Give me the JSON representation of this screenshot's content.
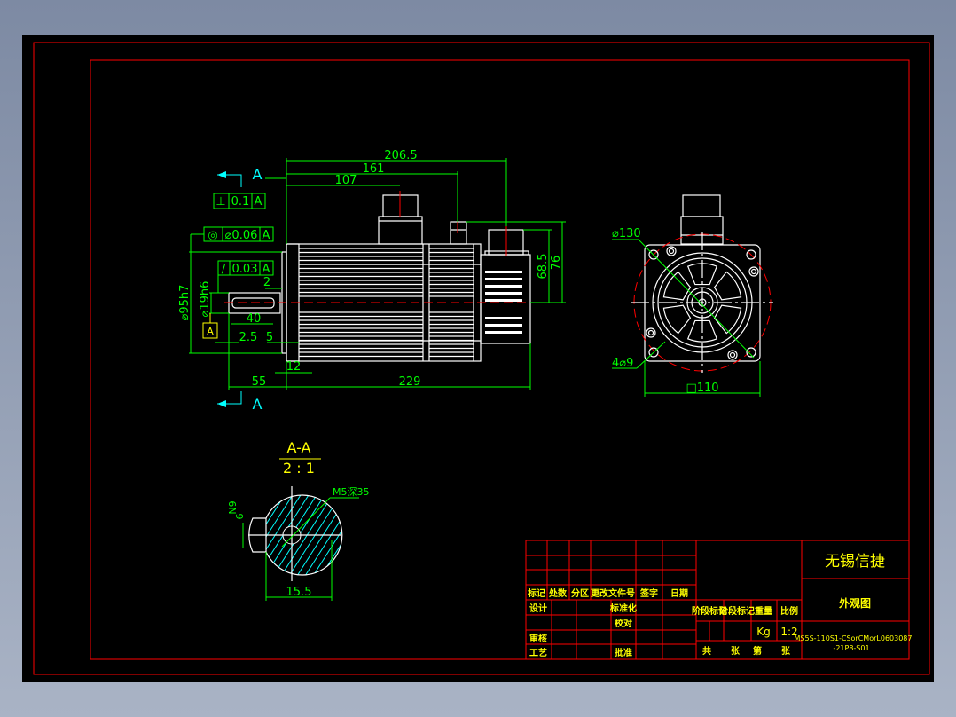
{
  "colors": {
    "background": "#000000",
    "frame": "#ff0000",
    "outline": "#ffffff",
    "dimension": "#00ff00",
    "annotation": "#ffff00",
    "section_marker": "#00ffff"
  },
  "side_view": {
    "dims": {
      "overall": "206.5",
      "to_encoder_connector": "161",
      "to_power_connector": "107",
      "h_68_5": "68.5",
      "h_76": "76",
      "shaft_len": "55",
      "body_len": "229",
      "key_len": "40",
      "d_2_5": "2.5",
      "d_5": "5",
      "d_12": "12",
      "d_2": "2",
      "flange_dia": "⌀95h7",
      "shaft_dia": "⌀19h6"
    },
    "tolerances": [
      {
        "symbol": "⊥",
        "value": "0.1",
        "datum": "A"
      },
      {
        "symbol": "◎",
        "value": "⌀0.06",
        "datum": "A"
      },
      {
        "symbol": "∕",
        "value": "0.03",
        "datum": "A"
      }
    ],
    "datum_label": "A",
    "section_marks": [
      "A",
      "A"
    ]
  },
  "front_view": {
    "pcd": "⌀130",
    "holes": "4⌀9",
    "square": "□110"
  },
  "section": {
    "title": "A-A",
    "scale": "2 : 1",
    "thread": "M5深35",
    "key_width": "N9",
    "key_depth": "6",
    "shaft_depth": "15.5"
  },
  "title_block": {
    "company": "无锡信捷",
    "drawing_name": "外观图",
    "part_number_line1": "MS5S-110S1-CSorCMorL0603087",
    "part_number_line2": "-21P8-S01",
    "headers": [
      "标记",
      "处数",
      "分区",
      "更改文件号",
      "签字",
      "日期"
    ],
    "design": "设计",
    "standardize": "标准化",
    "check": "校对",
    "review": "审核",
    "process": "工艺",
    "approve": "批准",
    "stage_mark": "阶段标记",
    "weight": "重量",
    "scale_label": "比例",
    "weight_unit": "Kg",
    "scale": "1:2",
    "total": "共",
    "sheets": "张",
    "sheet_no": "第",
    "sheet_unit": "张"
  }
}
